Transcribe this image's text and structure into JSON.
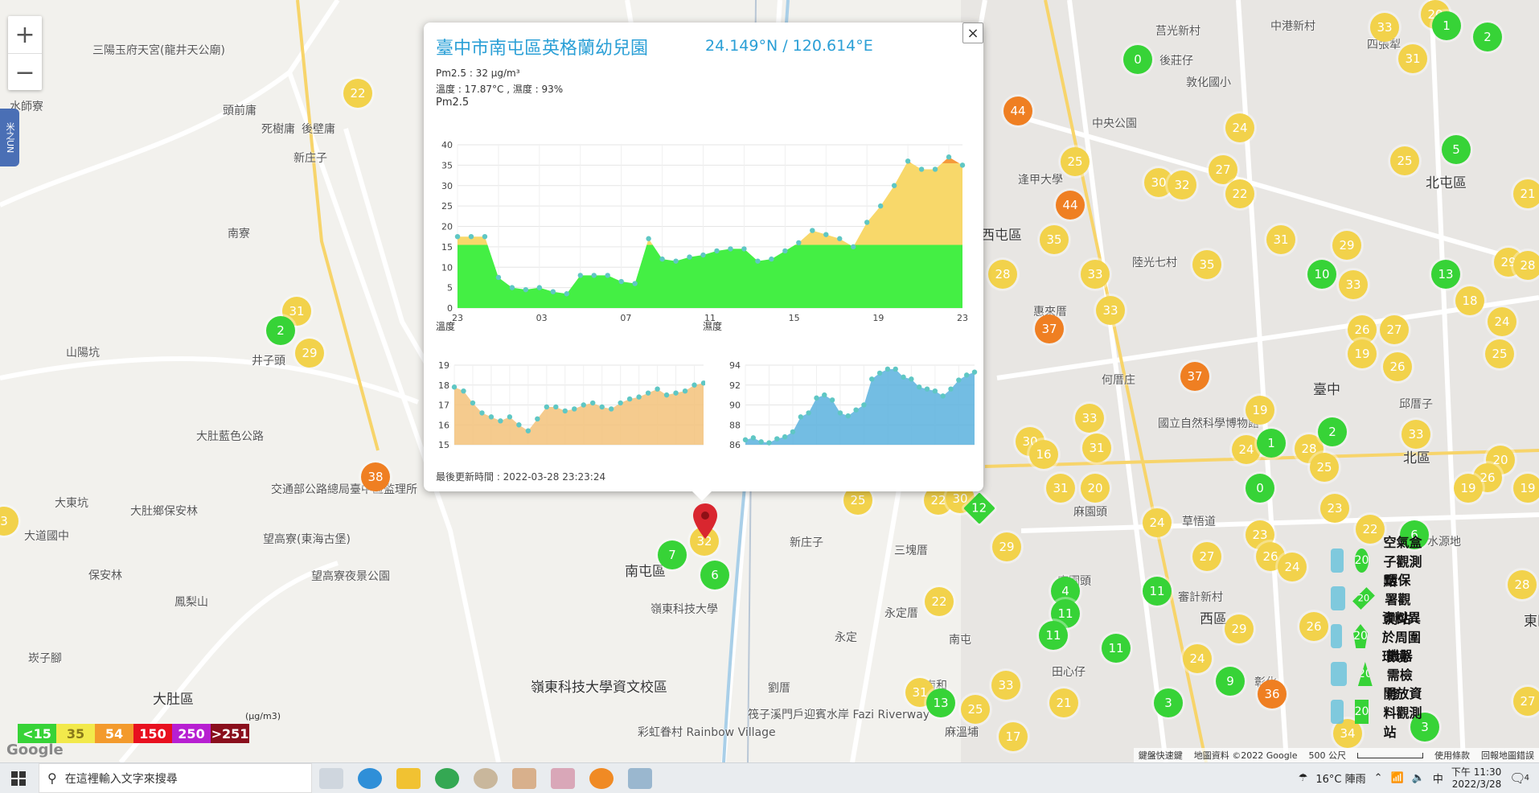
{
  "map": {
    "zoom_in": "+",
    "zoom_out": "−",
    "side_tab": "米之UN",
    "places": [
      {
        "name": "三陽玉府天宮(龍井天公廟)",
        "x": 115,
        "y": 52
      },
      {
        "name": "水師寮",
        "x": 12,
        "y": 122
      },
      {
        "name": "頭前庸",
        "x": 277,
        "y": 127
      },
      {
        "name": "死樹庸",
        "x": 325,
        "y": 150
      },
      {
        "name": "後壁庸",
        "x": 375,
        "y": 150
      },
      {
        "name": "新庄子",
        "x": 365,
        "y": 186
      },
      {
        "name": "南寮",
        "x": 283,
        "y": 280
      },
      {
        "name": "山陽坑",
        "x": 82,
        "y": 428
      },
      {
        "name": "井子頭",
        "x": 313,
        "y": 438
      },
      {
        "name": "大肚藍色公路",
        "x": 244,
        "y": 532
      },
      {
        "name": "交通部公路總局臺中區監理所",
        "x": 337,
        "y": 598
      },
      {
        "name": "大東坑",
        "x": 68,
        "y": 615
      },
      {
        "name": "大肚鄉保安林",
        "x": 162,
        "y": 625
      },
      {
        "name": "大道國中",
        "x": 30,
        "y": 656
      },
      {
        "name": "望高寮(東海古堡)",
        "x": 327,
        "y": 660
      },
      {
        "name": "保安林",
        "x": 110,
        "y": 705
      },
      {
        "name": "望高寮夜景公園",
        "x": 387,
        "y": 706
      },
      {
        "name": "鳳梨山",
        "x": 217,
        "y": 738
      },
      {
        "name": "崁子腳",
        "x": 35,
        "y": 808
      },
      {
        "name": "大肚區",
        "x": 190,
        "y": 855
      },
      {
        "name": "南屯區",
        "x": 777,
        "y": 696
      },
      {
        "name": "新庄子",
        "x": 982,
        "y": 664
      },
      {
        "name": "三塊厝",
        "x": 1112,
        "y": 674
      },
      {
        "name": "永定厝",
        "x": 1100,
        "y": 752
      },
      {
        "name": "永定",
        "x": 1038,
        "y": 782
      },
      {
        "name": "南屯",
        "x": 1180,
        "y": 785
      },
      {
        "name": "劉厝",
        "x": 955,
        "y": 845
      },
      {
        "name": "嶺東科技大學",
        "x": 809,
        "y": 747
      },
      {
        "name": "嶺東科技大學資文校區",
        "x": 660,
        "y": 840
      },
      {
        "name": "筏子溪門戶迎賓水岸 Fazi Riverway",
        "x": 930,
        "y": 878
      },
      {
        "name": "彩虹眷村 Rainbow Village",
        "x": 793,
        "y": 900
      },
      {
        "name": "莒光新村",
        "x": 1437,
        "y": 28
      },
      {
        "name": "中港新村",
        "x": 1580,
        "y": 22
      },
      {
        "name": "四張犁",
        "x": 1700,
        "y": 45
      },
      {
        "name": "後莊仔",
        "x": 1442,
        "y": 65
      },
      {
        "name": "敦化國小",
        "x": 1475,
        "y": 92
      },
      {
        "name": "中央公園",
        "x": 1358,
        "y": 143
      },
      {
        "name": "逢甲大學",
        "x": 1266,
        "y": 213
      },
      {
        "name": "北屯區",
        "x": 1773,
        "y": 213
      },
      {
        "name": "西屯區",
        "x": 1220,
        "y": 278
      },
      {
        "name": "陸光七村",
        "x": 1408,
        "y": 316
      },
      {
        "name": "惠來厝",
        "x": 1285,
        "y": 377
      },
      {
        "name": "何厝庄",
        "x": 1370,
        "y": 462
      },
      {
        "name": "臺中",
        "x": 1633,
        "y": 470
      },
      {
        "name": "邱厝子",
        "x": 1740,
        "y": 492
      },
      {
        "name": "北區",
        "x": 1745,
        "y": 555
      },
      {
        "name": "國立自然科學博物館",
        "x": 1440,
        "y": 516
      },
      {
        "name": "麻園頭",
        "x": 1335,
        "y": 626
      },
      {
        "name": "草悟道",
        "x": 1470,
        "y": 638
      },
      {
        "name": "水源地",
        "x": 1775,
        "y": 663
      },
      {
        "name": "麻園頭",
        "x": 1315,
        "y": 712
      },
      {
        "name": "審計新村",
        "x": 1465,
        "y": 732
      },
      {
        "name": "西區",
        "x": 1492,
        "y": 755
      },
      {
        "name": "東區",
        "x": 1895,
        "y": 758
      },
      {
        "name": "田心仔",
        "x": 1308,
        "y": 825
      },
      {
        "name": "南和",
        "x": 1150,
        "y": 842
      },
      {
        "name": "麻溫埔",
        "x": 1175,
        "y": 900
      },
      {
        "name": "彰化",
        "x": 1560,
        "y": 838
      }
    ],
    "markers": [
      {
        "v": "22",
        "c": "y",
        "x": 445,
        "y": 116
      },
      {
        "v": "31",
        "c": "y",
        "x": 369,
        "y": 387
      },
      {
        "v": "2",
        "c": "g",
        "x": 349,
        "y": 411
      },
      {
        "v": "29",
        "c": "y",
        "x": 385,
        "y": 439
      },
      {
        "v": "38",
        "c": "o",
        "x": 467,
        "y": 593
      },
      {
        "v": "3",
        "c": "y",
        "x": 5,
        "y": 648
      },
      {
        "v": "7",
        "c": "g",
        "x": 836,
        "y": 690
      },
      {
        "v": "32",
        "c": "y",
        "x": 876,
        "y": 673
      },
      {
        "v": "6",
        "c": "g",
        "x": 889,
        "y": 715
      },
      {
        "v": "25",
        "c": "y",
        "x": 1067,
        "y": 622
      },
      {
        "v": "22",
        "c": "y",
        "x": 1167,
        "y": 622
      },
      {
        "v": "30",
        "c": "y",
        "x": 1194,
        "y": 620
      },
      {
        "v": "12",
        "c": "g",
        "x": 1222,
        "y": 636,
        "d": true
      },
      {
        "v": "29",
        "c": "y",
        "x": 1252,
        "y": 680
      },
      {
        "v": "22",
        "c": "y",
        "x": 1168,
        "y": 748
      },
      {
        "v": "31",
        "c": "y",
        "x": 1144,
        "y": 861
      },
      {
        "v": "13",
        "c": "g",
        "x": 1170,
        "y": 874
      },
      {
        "v": "25",
        "c": "y",
        "x": 1213,
        "y": 882
      },
      {
        "v": "33",
        "c": "y",
        "x": 1251,
        "y": 852
      },
      {
        "v": "17",
        "c": "y",
        "x": 1260,
        "y": 916
      },
      {
        "v": "0",
        "c": "g",
        "x": 1415,
        "y": 74
      },
      {
        "v": "33",
        "c": "y",
        "x": 1722,
        "y": 34
      },
      {
        "v": "20",
        "c": "y",
        "x": 1785,
        "y": 18
      },
      {
        "v": "1",
        "c": "g",
        "x": 1799,
        "y": 32
      },
      {
        "v": "2",
        "c": "g",
        "x": 1850,
        "y": 46
      },
      {
        "v": "31",
        "c": "y",
        "x": 1757,
        "y": 73
      },
      {
        "v": "44",
        "c": "o",
        "x": 1266,
        "y": 138
      },
      {
        "v": "24",
        "c": "y",
        "x": 1542,
        "y": 159
      },
      {
        "v": "25",
        "c": "y",
        "x": 1337,
        "y": 201
      },
      {
        "v": "27",
        "c": "y",
        "x": 1521,
        "y": 211
      },
      {
        "v": "30",
        "c": "y",
        "x": 1441,
        "y": 227
      },
      {
        "v": "32",
        "c": "y",
        "x": 1470,
        "y": 230
      },
      {
        "v": "22",
        "c": "y",
        "x": 1542,
        "y": 241
      },
      {
        "v": "25",
        "c": "y",
        "x": 1747,
        "y": 200
      },
      {
        "v": "5",
        "c": "g",
        "x": 1811,
        "y": 186
      },
      {
        "v": "44",
        "c": "o",
        "x": 1331,
        "y": 255
      },
      {
        "v": "35",
        "c": "y",
        "x": 1311,
        "y": 298
      },
      {
        "v": "31",
        "c": "y",
        "x": 1593,
        "y": 298
      },
      {
        "v": "29",
        "c": "y",
        "x": 1675,
        "y": 305
      },
      {
        "v": "35",
        "c": "y",
        "x": 1501,
        "y": 329
      },
      {
        "v": "10",
        "c": "g",
        "x": 1644,
        "y": 341
      },
      {
        "v": "33",
        "c": "y",
        "x": 1683,
        "y": 354
      },
      {
        "v": "13",
        "c": "g",
        "x": 1798,
        "y": 341
      },
      {
        "v": "28",
        "c": "y",
        "x": 1247,
        "y": 341
      },
      {
        "v": "33",
        "c": "y",
        "x": 1362,
        "y": 341
      },
      {
        "v": "33",
        "c": "y",
        "x": 1381,
        "y": 386
      },
      {
        "v": "37",
        "c": "o",
        "x": 1305,
        "y": 409
      },
      {
        "v": "26",
        "c": "y",
        "x": 1694,
        "y": 410
      },
      {
        "v": "27",
        "c": "y",
        "x": 1734,
        "y": 410
      },
      {
        "v": "19",
        "c": "y",
        "x": 1694,
        "y": 440
      },
      {
        "v": "26",
        "c": "y",
        "x": 1738,
        "y": 456
      },
      {
        "v": "37",
        "c": "o",
        "x": 1486,
        "y": 468
      },
      {
        "v": "19",
        "c": "y",
        "x": 1567,
        "y": 510
      },
      {
        "v": "33",
        "c": "y",
        "x": 1355,
        "y": 520
      },
      {
        "v": "30",
        "c": "y",
        "x": 1281,
        "y": 549
      },
      {
        "v": "16",
        "c": "y",
        "x": 1298,
        "y": 565
      },
      {
        "v": "31",
        "c": "y",
        "x": 1364,
        "y": 557
      },
      {
        "v": "31",
        "c": "y",
        "x": 1319,
        "y": 607
      },
      {
        "v": "20",
        "c": "y",
        "x": 1362,
        "y": 607
      },
      {
        "v": "24",
        "c": "y",
        "x": 1550,
        "y": 559
      },
      {
        "v": "1",
        "c": "g",
        "x": 1581,
        "y": 551
      },
      {
        "v": "28",
        "c": "y",
        "x": 1628,
        "y": 558
      },
      {
        "v": "25",
        "c": "y",
        "x": 1647,
        "y": 581
      },
      {
        "v": "2",
        "c": "g",
        "x": 1657,
        "y": 537
      },
      {
        "v": "33",
        "c": "y",
        "x": 1761,
        "y": 540
      },
      {
        "v": "0",
        "c": "g",
        "x": 1567,
        "y": 607
      },
      {
        "v": "24",
        "c": "y",
        "x": 1439,
        "y": 650
      },
      {
        "v": "23",
        "c": "y",
        "x": 1660,
        "y": 632
      },
      {
        "v": "22",
        "c": "y",
        "x": 1704,
        "y": 658
      },
      {
        "v": "6",
        "c": "g",
        "x": 1759,
        "y": 665
      },
      {
        "v": "23",
        "c": "y",
        "x": 1567,
        "y": 665
      },
      {
        "v": "26",
        "c": "y",
        "x": 1580,
        "y": 692
      },
      {
        "v": "24",
        "c": "y",
        "x": 1607,
        "y": 705
      },
      {
        "v": "27",
        "c": "y",
        "x": 1501,
        "y": 692
      },
      {
        "v": "11",
        "c": "g",
        "x": 1439,
        "y": 735
      },
      {
        "v": "4",
        "c": "g",
        "x": 1325,
        "y": 735
      },
      {
        "v": "11",
        "c": "g",
        "x": 1325,
        "y": 763
      },
      {
        "v": "11",
        "c": "g",
        "x": 1310,
        "y": 790
      },
      {
        "v": "11",
        "c": "g",
        "x": 1388,
        "y": 806
      },
      {
        "v": "29",
        "c": "y",
        "x": 1541,
        "y": 782
      },
      {
        "v": "26",
        "c": "y",
        "x": 1634,
        "y": 779
      },
      {
        "v": "24",
        "c": "y",
        "x": 1489,
        "y": 819
      },
      {
        "v": "9",
        "c": "g",
        "x": 1530,
        "y": 847
      },
      {
        "v": "36",
        "c": "o",
        "x": 1582,
        "y": 863
      },
      {
        "v": "3",
        "c": "g",
        "x": 1453,
        "y": 874
      },
      {
        "v": "21",
        "c": "y",
        "x": 1323,
        "y": 874
      },
      {
        "v": "34",
        "c": "y",
        "x": 1676,
        "y": 912
      },
      {
        "v": "3",
        "c": "g",
        "x": 1772,
        "y": 904
      },
      {
        "v": "29",
        "c": "y",
        "x": 1876,
        "y": 326
      },
      {
        "v": "28",
        "c": "y",
        "x": 1900,
        "y": 330
      },
      {
        "v": "18",
        "c": "y",
        "x": 1828,
        "y": 374
      },
      {
        "v": "24",
        "c": "y",
        "x": 1868,
        "y": 400
      },
      {
        "v": "25",
        "c": "y",
        "x": 1865,
        "y": 440
      },
      {
        "v": "20",
        "c": "y",
        "x": 1866,
        "y": 572
      },
      {
        "v": "26",
        "c": "y",
        "x": 1850,
        "y": 594
      },
      {
        "v": "19",
        "c": "y",
        "x": 1826,
        "y": 607
      },
      {
        "v": "19",
        "c": "y",
        "x": 1900,
        "y": 607
      },
      {
        "v": "21",
        "c": "y",
        "x": 1900,
        "y": 241
      },
      {
        "v": "28",
        "c": "y",
        "x": 1893,
        "y": 727
      },
      {
        "v": "27",
        "c": "y",
        "x": 1900,
        "y": 872
      }
    ],
    "aqi_legend": [
      {
        "label": "<15",
        "color": "#37d337"
      },
      {
        "label": "35",
        "color": "#f2e94b"
      },
      {
        "label": "54",
        "color": "#f39a2c"
      },
      {
        "label": "150",
        "color": "#e8101f"
      },
      {
        "label": "250",
        "color": "#b71fd1"
      },
      {
        "label": ">251",
        "color": "#8a0f1c"
      }
    ],
    "aqi_unit": "(μg/m3)",
    "google_logo": "Google",
    "attribution": {
      "shortcuts": "鍵盤快速鍵",
      "map_data": "地圖資料 ©2022 Google",
      "scale": "500 公尺",
      "terms": "使用條款",
      "report": "回報地圖錯誤"
    },
    "station_legend": [
      {
        "label": "空氣盒子觀測點",
        "value": "20",
        "shape": "circle",
        "color": "#37d337"
      },
      {
        "label": "環保署觀測站",
        "value": "20",
        "shape": "diamond",
        "color": "#37d337"
      },
      {
        "label": "資料異於周圍環境",
        "value": "20",
        "shape": "pentagon",
        "color": "#37d337"
      },
      {
        "label": "機器需檢修",
        "value": "20",
        "shape": "triangle",
        "color": "#37d337"
      },
      {
        "label": "開放資料觀測站",
        "value": "20",
        "shape": "square",
        "color": "#37d337"
      }
    ]
  },
  "popup": {
    "title": "臺中市南屯區英格蘭幼兒園",
    "coords": "24.149°N / 120.614°E",
    "pm25_line": "Pm2.5 : 32 μg/m³",
    "temp_humid_line": "溫度 : 17.87°C , 濕度 : 93%",
    "close": "×",
    "updated": "最後更新時間 : 2022-03-28 23:23:24"
  },
  "chart_data": [
    {
      "type": "area",
      "title": "Pm2.5",
      "xlabel": "",
      "ylabel": "",
      "ylim": [
        0,
        40
      ],
      "yticks": [
        0,
        5,
        10,
        15,
        20,
        25,
        30,
        35,
        40
      ],
      "xticks": [
        "23",
        "03",
        "07",
        "11",
        "15",
        "19",
        "23"
      ],
      "grid": true,
      "threshold_colors": [
        {
          "max": 15.5,
          "color": "#44ef44"
        },
        {
          "max": 35.5,
          "color": "#f8d86a"
        },
        {
          "max": 40,
          "color": "#f59a3a"
        }
      ],
      "values": [
        17.5,
        17.5,
        17.5,
        7.5,
        5,
        4.5,
        5,
        4,
        3.5,
        8,
        8,
        8,
        6.5,
        6,
        17,
        12,
        11.5,
        12.5,
        13,
        14,
        14.5,
        14.5,
        11.5,
        12,
        14,
        16,
        19,
        18,
        17,
        15,
        21,
        25,
        30,
        36,
        34,
        34,
        37,
        35
      ]
    },
    {
      "type": "area",
      "title": "溫度",
      "ylim": [
        15,
        19
      ],
      "yticks": [
        15,
        16,
        17,
        18,
        19
      ],
      "grid": true,
      "color": "#f3c27a",
      "values": [
        17.9,
        17.7,
        17.1,
        16.6,
        16.4,
        16.2,
        16.4,
        16.0,
        15.7,
        16.3,
        16.9,
        16.9,
        16.7,
        16.8,
        17.0,
        17.1,
        16.9,
        16.8,
        17.1,
        17.3,
        17.4,
        17.6,
        17.8,
        17.5,
        17.6,
        17.7,
        18.0,
        18.1
      ]
    },
    {
      "type": "area",
      "title": "濕度",
      "ylim": [
        86,
        94
      ],
      "yticks": [
        86,
        88,
        90,
        92,
        94
      ],
      "grid": true,
      "color": "#5bb2de",
      "values": [
        86.5,
        86.7,
        86.3,
        86.2,
        86.6,
        86.8,
        87.3,
        88.8,
        89.2,
        90.7,
        91.0,
        90.5,
        89.2,
        88.9,
        89.5,
        90.0,
        92.6,
        93.2,
        93.6,
        93.6,
        92.8,
        92.6,
        91.8,
        91.6,
        91.4,
        90.9,
        91.6,
        92.5,
        93.0,
        93.3
      ]
    }
  ],
  "taskbar": {
    "search_placeholder": "在這裡輸入文字來搜尋",
    "weather": "16°C 陣雨",
    "ime": "中",
    "time": "下午 11:30",
    "date": "2022/3/28",
    "notif_count": "4"
  }
}
